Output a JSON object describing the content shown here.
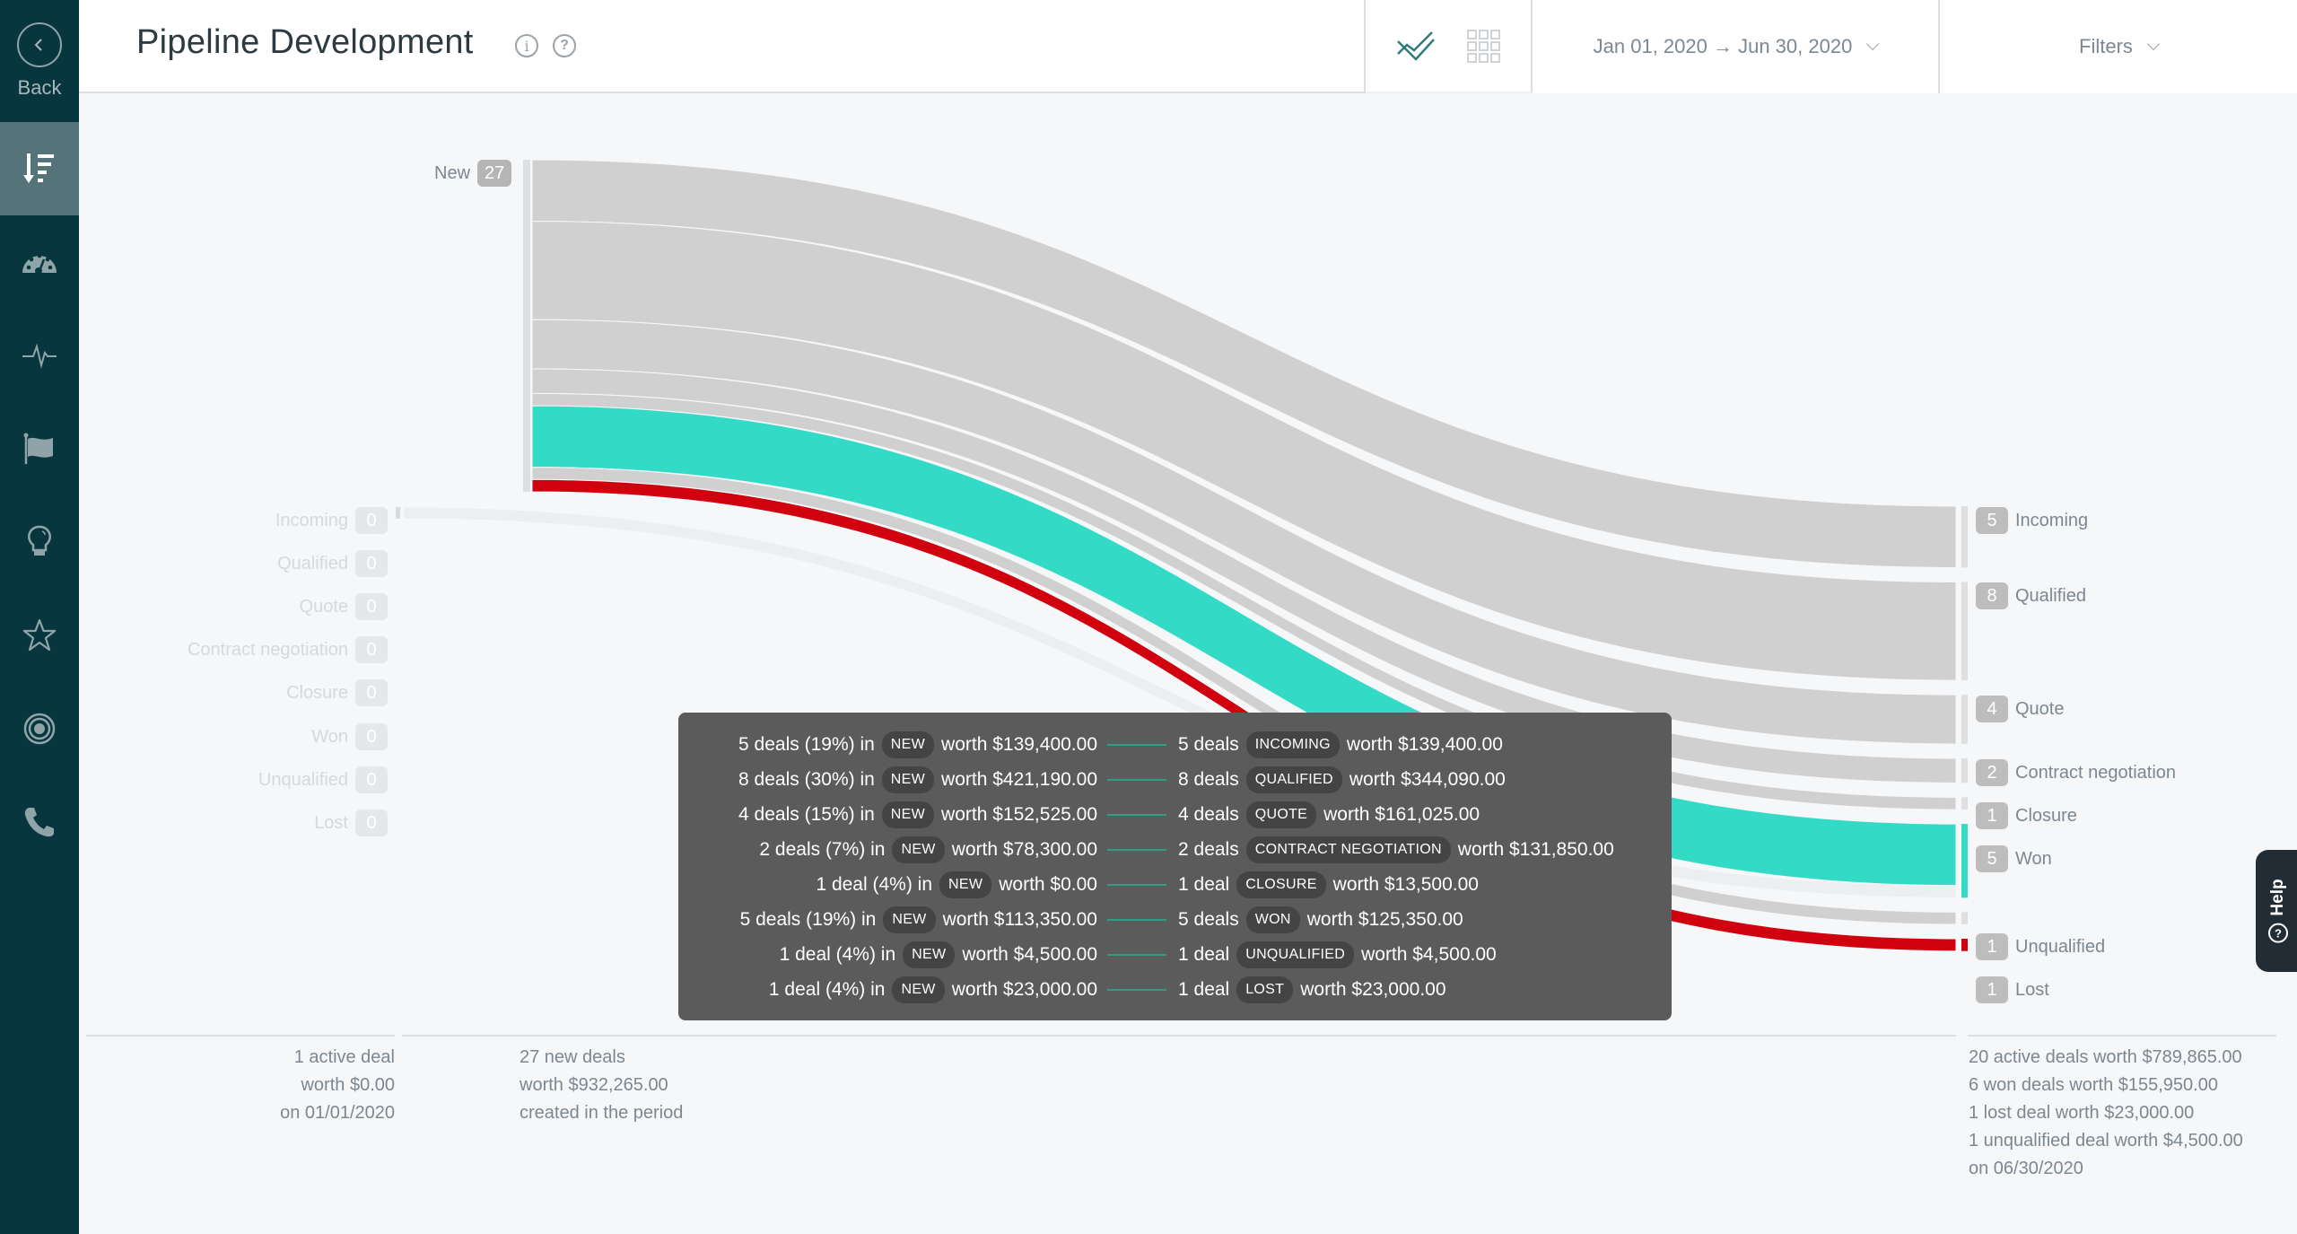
{
  "sidebar": {
    "back_label": "Back",
    "items": [
      {
        "name": "pipeline-development",
        "icon": "sort-descending-icon",
        "active": true
      },
      {
        "name": "dashboard",
        "icon": "speedometer-icon",
        "active": false
      },
      {
        "name": "activity",
        "icon": "pulse-icon",
        "active": false
      },
      {
        "name": "goals",
        "icon": "flag-icon",
        "active": false
      },
      {
        "name": "insights",
        "icon": "lightbulb-icon",
        "active": false
      },
      {
        "name": "favorites",
        "icon": "star-icon",
        "active": false
      },
      {
        "name": "targets",
        "icon": "target-icon",
        "active": false
      },
      {
        "name": "calls",
        "icon": "phone-icon",
        "active": false
      }
    ]
  },
  "header": {
    "title": "Pipeline Development",
    "info_icon": "info-icon",
    "help_icon": "question-icon",
    "view_toggle": [
      {
        "name": "chart-view",
        "icon": "chart-lines-icon",
        "active": true,
        "color": "#2f7d7a"
      },
      {
        "name": "grid-view",
        "icon": "grid-icon",
        "active": false
      }
    ],
    "date_range": "Jan 01, 2020 → Jun 30, 2020",
    "filters_label": "Filters"
  },
  "chart_data": {
    "type": "sankey",
    "title": "Pipeline Development",
    "colors": {
      "default": "#d0d0d0",
      "won": "#33dbc7",
      "lost": "#d0000f",
      "faint": "#eceeef"
    },
    "source_node": {
      "label": "New",
      "count": 27
    },
    "left_nodes": [
      {
        "label": "Incoming",
        "count": 0
      },
      {
        "label": "Qualified",
        "count": 0
      },
      {
        "label": "Quote",
        "count": 0
      },
      {
        "label": "Contract negotiation",
        "count": 0
      },
      {
        "label": "Closure",
        "count": 0
      },
      {
        "label": "Won",
        "count": 0
      },
      {
        "label": "Unqualified",
        "count": 0
      },
      {
        "label": "Lost",
        "count": 0
      }
    ],
    "right_nodes": [
      {
        "label": "Incoming",
        "count": 5
      },
      {
        "label": "Qualified",
        "count": 8
      },
      {
        "label": "Quote",
        "count": 4
      },
      {
        "label": "Contract negotiation",
        "count": 2
      },
      {
        "label": "Closure",
        "count": 1
      },
      {
        "label": "Won",
        "count": 5
      },
      {
        "label": "Unqualified",
        "count": 1
      },
      {
        "label": "Lost",
        "count": 1
      }
    ],
    "flows": [
      {
        "from": "New",
        "to": "Incoming",
        "deals": 5,
        "color": "default"
      },
      {
        "from": "New",
        "to": "Qualified",
        "deals": 8,
        "color": "default"
      },
      {
        "from": "New",
        "to": "Quote",
        "deals": 4,
        "color": "default"
      },
      {
        "from": "New",
        "to": "Contract negotiation",
        "deals": 2,
        "color": "default"
      },
      {
        "from": "New",
        "to": "Closure",
        "deals": 1,
        "color": "default"
      },
      {
        "from": "New",
        "to": "Won",
        "deals": 5,
        "color": "won"
      },
      {
        "from": "New",
        "to": "Unqualified",
        "deals": 1,
        "color": "default"
      },
      {
        "from": "New",
        "to": "Lost",
        "deals": 1,
        "color": "lost"
      },
      {
        "from": "Incoming (start)",
        "to": "Won",
        "deals": 1,
        "color": "faint"
      }
    ]
  },
  "tooltip": {
    "rows": [
      {
        "left": "5 deals (19%) in",
        "from_stage": "NEW",
        "from_worth": "worth $139,400.00",
        "right": "5 deals",
        "to_stage": "INCOMING",
        "to_worth": "worth $139,400.00"
      },
      {
        "left": "8 deals (30%) in",
        "from_stage": "NEW",
        "from_worth": "worth $421,190.00",
        "right": "8 deals",
        "to_stage": "QUALIFIED",
        "to_worth": "worth $344,090.00"
      },
      {
        "left": "4 deals (15%) in",
        "from_stage": "NEW",
        "from_worth": "worth $152,525.00",
        "right": "4 deals",
        "to_stage": "QUOTE",
        "to_worth": "worth $161,025.00"
      },
      {
        "left": "2 deals (7%) in",
        "from_stage": "NEW",
        "from_worth": "worth $78,300.00",
        "right": "2 deals",
        "to_stage": "CONTRACT NEGOTIATION",
        "to_worth": "worth $131,850.00"
      },
      {
        "left": "1 deal (4%) in",
        "from_stage": "NEW",
        "from_worth": "worth $0.00",
        "right": "1 deal",
        "to_stage": "CLOSURE",
        "to_worth": "worth $13,500.00"
      },
      {
        "left": "5 deals (19%) in",
        "from_stage": "NEW",
        "from_worth": "worth $113,350.00",
        "right": "5 deals",
        "to_stage": "WON",
        "to_worth": "worth $125,350.00"
      },
      {
        "left": "1 deal (4%) in",
        "from_stage": "NEW",
        "from_worth": "worth $4,500.00",
        "right": "1 deal",
        "to_stage": "UNQUALIFIED",
        "to_worth": "worth $4,500.00"
      },
      {
        "left": "1 deal (4%) in",
        "from_stage": "NEW",
        "from_worth": "worth $23,000.00",
        "right": "1 deal",
        "to_stage": "LOST",
        "to_worth": "worth $23,000.00"
      }
    ]
  },
  "summary": {
    "start": [
      "1 active deal",
      "worth $0.00",
      "on 01/01/2020"
    ],
    "new": [
      "27 new deals",
      "worth $932,265.00",
      "created in the period"
    ],
    "end": [
      "20 active deals worth $789,865.00",
      "6 won deals worth $155,950.00",
      "1 lost deal worth $23,000.00",
      "1 unqualified deal worth $4,500.00",
      "on 06/30/2020"
    ]
  },
  "help_tab": {
    "label": "Help"
  }
}
